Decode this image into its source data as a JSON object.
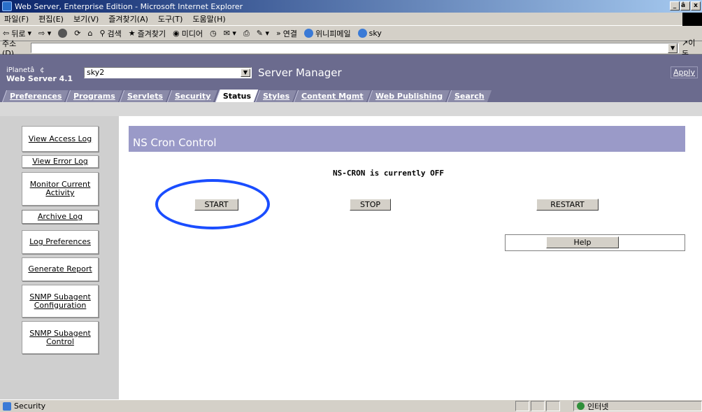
{
  "window": {
    "title": "Web Server, Enterprise Edition - Microsoft Internet Explorer",
    "controls": [
      "_",
      "â¡",
      "x"
    ]
  },
  "menubar": [
    "파일(F)",
    "편집(E)",
    "보기(V)",
    "즐겨찾기(A)",
    "도구(T)",
    "도움말(H)"
  ],
  "toolbar": {
    "back": "뒤로",
    "search": "검색",
    "favorites": "즐겨찾기",
    "media": "미디어",
    "links_label": "연결",
    "link1": "위니피메일",
    "link2": "sky"
  },
  "addressbar": {
    "label": "주소(D)",
    "value": "",
    "go": "이동"
  },
  "banner": {
    "brand1": "iPlanetâ¢",
    "brand2": "Web Server 4.1",
    "server_select": "sky2",
    "title": "Server Manager",
    "apply": "Apply"
  },
  "tabs": [
    "Preferences",
    "Programs",
    "Servlets",
    "Security",
    "Status",
    "Styles",
    "Content Mgmt",
    "Web Publishing",
    "Search"
  ],
  "active_tab": "Status",
  "sidebar": {
    "items": [
      {
        "label": "View Access Log"
      },
      {
        "label": "View Error Log"
      },
      {
        "label": "Monitor Current Activity"
      },
      {
        "label": "Archive Log"
      },
      {
        "label": "Log Preferences"
      },
      {
        "label": "Generate Report"
      },
      {
        "label": "SNMP Subagent Configuration"
      },
      {
        "label": "SNMP Subagent Control"
      }
    ]
  },
  "panel": {
    "title": "NS Cron Control",
    "status": "NS-CRON is currently OFF",
    "start": "START",
    "stop": "STOP",
    "restart": "RESTART",
    "help": "Help"
  },
  "statusbar": {
    "left": "Security",
    "zone": "인터넷"
  },
  "colors": {
    "banner": "#6b6b8e",
    "panel_header": "#9a9ac8",
    "highlight_circle": "#1a4dff"
  }
}
